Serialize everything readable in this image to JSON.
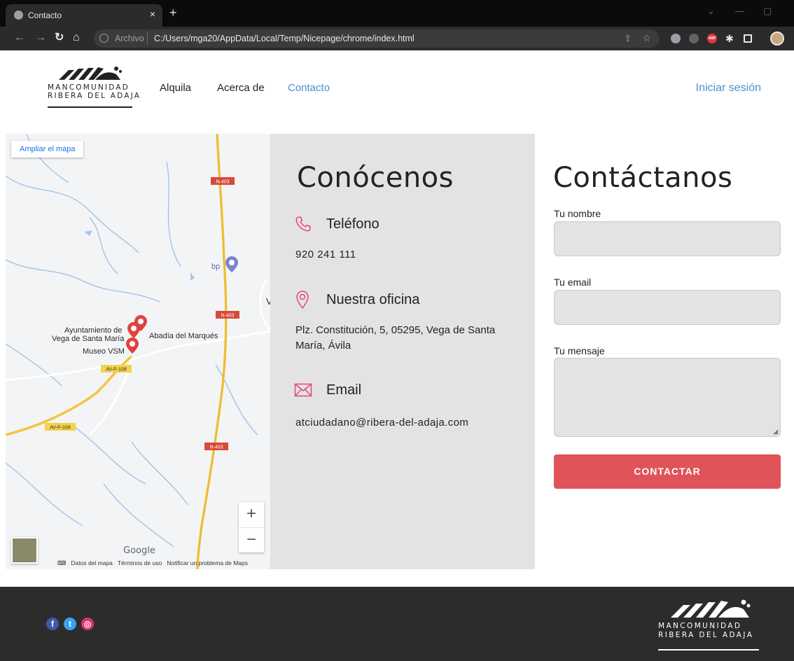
{
  "browser": {
    "tab_title": "Contacto",
    "tab_close": "×",
    "new_tab": "+",
    "scheme_label": "Archivo",
    "url": "C:/Users/mga20/AppData/Local/Temp/Nicepage/chrome/index.html",
    "ext_abp": "ABP"
  },
  "header": {
    "logo_line1": "MANCOMUNIDAD",
    "logo_line2": "RIBERA DEL ADAJA",
    "nav": [
      "Alquila",
      "Acerca de",
      "Contacto"
    ],
    "active_nav": "Contacto",
    "login": "Iniciar sesión",
    "accent": "#4a8fc8"
  },
  "map": {
    "enlarge": "Ampliar el mapa",
    "road_labels": [
      "N-403",
      "N-403",
      "N-403",
      "AV-P-108",
      "AV-P-108"
    ],
    "places": [
      "Ayuntamiento de",
      "Vega de Santa María",
      "Abadía del Marqués",
      "Museo VSM",
      "bp"
    ],
    "partial_label": "V",
    "zoom_in": "+",
    "zoom_out": "−",
    "google": "Google",
    "attribution": [
      "Datos del mapa",
      "Términos de uso",
      "Notificar un problema de Maps"
    ]
  },
  "info": {
    "title": "Conócenos",
    "phone_title": "Teléfono",
    "phone": "920 241 111",
    "office_title": "Nuestra oficina",
    "address": "Plz. Constitución, 5, 05295, Vega de Santa María, Ávila",
    "email_title": "Email",
    "email": "atciudadano@ribera-del-adaja.com",
    "icon_color": "#e6447f"
  },
  "form": {
    "title": "Contáctanos",
    "name_label": "Tu nombre",
    "email_label": "Tu email",
    "message_label": "Tu mensaje",
    "submit": "CONTACTAR",
    "submit_color": "#e05358"
  },
  "footer": {
    "social": [
      "facebook",
      "twitter",
      "instagram"
    ],
    "logo_line1": "MANCOMUNIDAD",
    "logo_line2": "RIBERA DEL ADAJA"
  }
}
